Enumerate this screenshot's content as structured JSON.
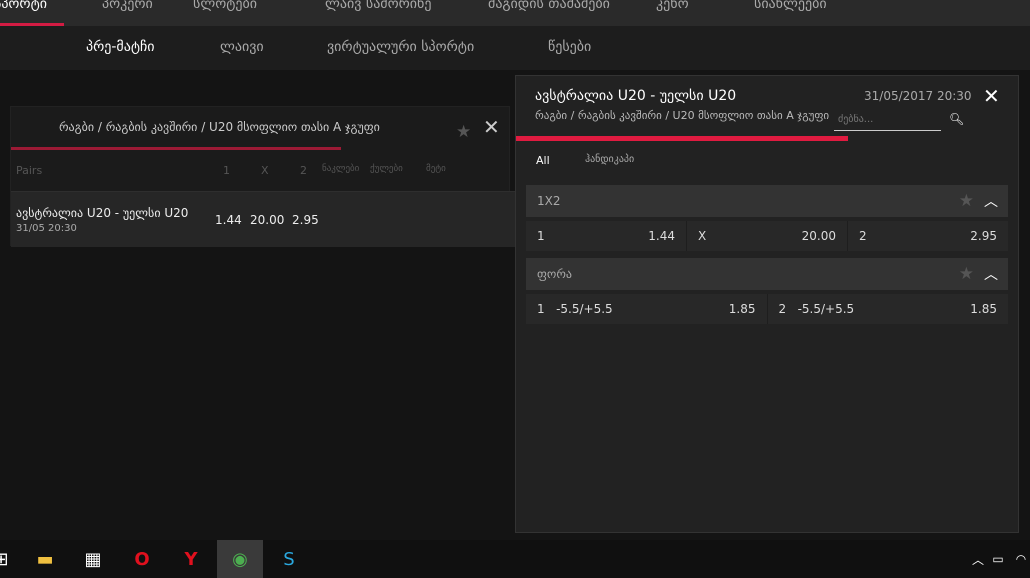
{
  "top_nav": [
    "სპორტი",
    "პოკერი",
    "სლოტები",
    "ლაივ სამორინე",
    "მაგიდის თამაშები",
    "კენო",
    "სიახლეები"
  ],
  "sub_nav": [
    "პრე-მატჩი",
    "ლაივი",
    "ვირტუალური სპორტი",
    "წესები"
  ],
  "left_panel": {
    "breadcrumb": "რაგბი / რაგბის კავშირი / U20 მსოფლიო თასი A ჯგუფი",
    "headers": [
      "Pairs",
      "1",
      "X",
      "2",
      "ნაკლები",
      "ქულები",
      "მეტი"
    ],
    "match": {
      "name": "ავსტრალია U20 - უელსი U20",
      "date": "31/05 20:30",
      "odds": [
        "1.44",
        "20.00",
        "2.95"
      ]
    }
  },
  "right_panel": {
    "title": "ავსტრალია U20 - უელსი U20",
    "datetime": "31/05/2017 20:30",
    "breadcrumb": "რაგბი / რაგბის კავშირი / U20 მსოფლიო თასი A ჯგუფი",
    "search_placeholder": "ძებნა...",
    "tabs": [
      "All",
      "ჰანდიკაპი"
    ],
    "markets": [
      {
        "name": "1X2",
        "outcomes": [
          {
            "label": "1",
            "odd": "1.44"
          },
          {
            "label": "X",
            "odd": "20.00"
          },
          {
            "label": "2",
            "odd": "2.95"
          }
        ]
      },
      {
        "name": "ფორა",
        "outcomes": [
          {
            "label": "1   -5.5/+5.5",
            "odd": "1.85"
          },
          {
            "label": "2   -5.5/+5.5",
            "odd": "1.85"
          }
        ]
      }
    ]
  },
  "colors": {
    "accent": "#e01b40"
  },
  "taskbar": [
    "start-icon",
    "file-explorer-icon",
    "store-icon",
    "opera-icon",
    "yandex-icon",
    "chrome-icon",
    "skype-icon"
  ]
}
